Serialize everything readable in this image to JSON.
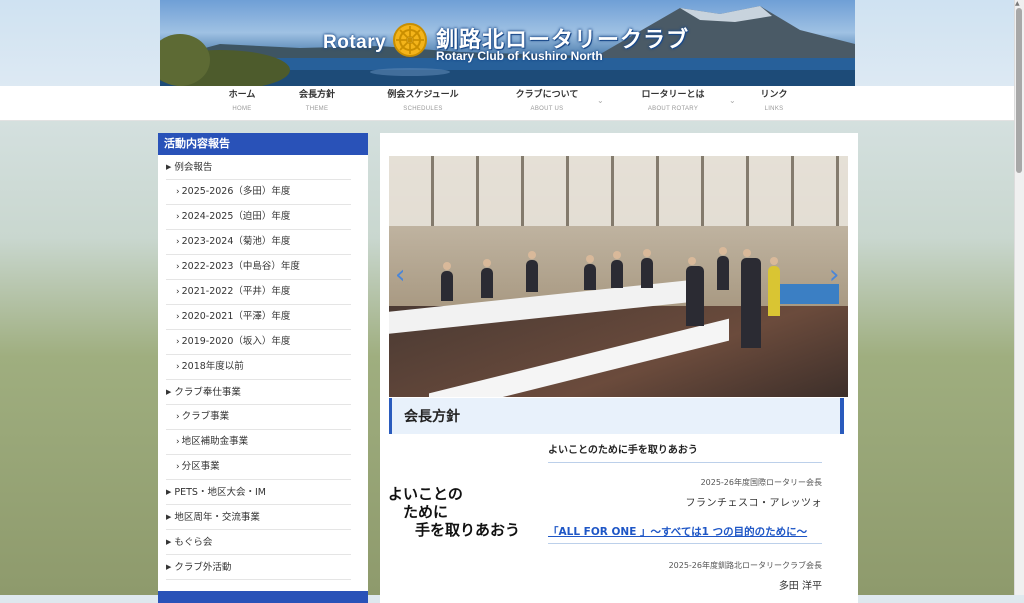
{
  "header": {
    "logo_word": "Rotary",
    "club_name_jp": "釧路北ロータリークラブ",
    "club_name_en": "Rotary Club of Kushiro North"
  },
  "nav": [
    {
      "jp": "ホーム",
      "en": "HOME",
      "dropdown": false
    },
    {
      "jp": "会長方針",
      "en": "THEME",
      "dropdown": false
    },
    {
      "jp": "例会スケジュール",
      "en": "SCHEDULES",
      "dropdown": false
    },
    {
      "jp": "クラブについて",
      "en": "ABOUT US",
      "dropdown": true
    },
    {
      "jp": "ロータリーとは",
      "en": "ABOUT ROTARY",
      "dropdown": true
    },
    {
      "jp": "リンク",
      "en": "LINKS",
      "dropdown": false
    }
  ],
  "sidebar": {
    "title": "活動内容報告",
    "items": [
      {
        "label": "例会報告",
        "level": 1
      },
      {
        "label": "2025-2026（多田）年度",
        "level": 2
      },
      {
        "label": "2024-2025（迫田）年度",
        "level": 2
      },
      {
        "label": "2023-2024（菊池）年度",
        "level": 2
      },
      {
        "label": "2022-2023（中島谷）年度",
        "level": 2
      },
      {
        "label": "2021-2022（平井）年度",
        "level": 2
      },
      {
        "label": "2020-2021（平澤）年度",
        "level": 2
      },
      {
        "label": "2019-2020（坂入）年度",
        "level": 2
      },
      {
        "label": "2018年度以前",
        "level": 2
      },
      {
        "label": "クラブ奉仕事業",
        "level": 1
      },
      {
        "label": "クラブ事業",
        "level": 2
      },
      {
        "label": "地区補助金事業",
        "level": 2
      },
      {
        "label": "分区事業",
        "level": 2
      },
      {
        "label": "PETS・地区大会・IM",
        "level": 1
      },
      {
        "label": "地区周年・交流事業",
        "level": 1
      },
      {
        "label": "もぐら会",
        "level": 1
      },
      {
        "label": "クラブ外活動",
        "level": 1
      }
    ]
  },
  "slider": {
    "prev": "‹",
    "next": "›"
  },
  "main": {
    "section_title": "会長方針",
    "slogan": [
      "よいことの",
      "ために",
      "手を取りあおう"
    ],
    "heading": "よいことのために手を取りあおう",
    "ri_president_caption": "2025-26年度国際ロータリー会長",
    "ri_president_name": "フランチェスコ・アレッツォ",
    "club_theme": "「ALL FOR ONE 」～すべては1 つの目的のために～",
    "club_president_caption": "2025-26年度釧路北ロータリークラブ会長",
    "club_president_name": "多田 洋平"
  },
  "colors": {
    "accent_blue": "#2952b8",
    "link_blue": "#1e56c6",
    "title_bg": "#e8f1fb"
  }
}
